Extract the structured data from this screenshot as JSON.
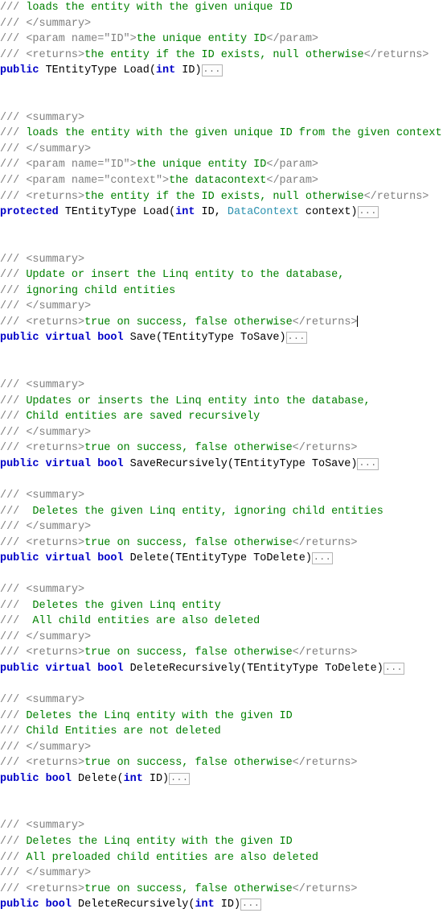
{
  "editor": {
    "kind": "code-editor-pane",
    "language": "C#",
    "background_color": "#ffffff",
    "colors": {
      "doc_tag": "#808080",
      "doc_text": "#008000",
      "keyword": "#0000C8",
      "type": "#2B91AF",
      "plain_text": "#000000",
      "collapsed_box_border": "#b4b4b4",
      "caret": "#000000"
    },
    "collapsed_region_label": "...",
    "caret_visible": true
  },
  "lines": [
    {
      "n": 1,
      "kind": "doc",
      "tokens": [
        {
          "t": "doc",
          "s": "/// "
        },
        {
          "t": "doctext",
          "s": "loads the entity with the given unique ID"
        }
      ]
    },
    {
      "n": 2,
      "kind": "doc",
      "tokens": [
        {
          "t": "doc",
          "s": "/// </summary>"
        }
      ]
    },
    {
      "n": 3,
      "kind": "doc",
      "tokens": [
        {
          "t": "doc",
          "s": "/// <param name=\"ID\">"
        },
        {
          "t": "doctext",
          "s": "the unique entity ID"
        },
        {
          "t": "doc",
          "s": "</param>"
        }
      ]
    },
    {
      "n": 4,
      "kind": "doc",
      "tokens": [
        {
          "t": "doc",
          "s": "/// <returns>"
        },
        {
          "t": "doctext",
          "s": "the entity if the ID exists, null otherwise"
        },
        {
          "t": "doc",
          "s": "</returns>"
        }
      ]
    },
    {
      "n": 5,
      "kind": "code",
      "tokens": [
        {
          "t": "keyword",
          "s": "public"
        },
        {
          "t": "plain",
          "s": " TEntityType Load("
        },
        {
          "t": "keyword",
          "s": "int"
        },
        {
          "t": "plain",
          "s": " ID)"
        },
        {
          "t": "collapsed",
          "s": "..."
        }
      ]
    },
    {
      "n": 6,
      "kind": "blank",
      "tokens": []
    },
    {
      "n": 7,
      "kind": "blank",
      "tokens": []
    },
    {
      "n": 8,
      "kind": "doc",
      "tokens": [
        {
          "t": "doc",
          "s": "/// <summary>"
        }
      ]
    },
    {
      "n": 9,
      "kind": "doc",
      "tokens": [
        {
          "t": "doc",
          "s": "/// "
        },
        {
          "t": "doctext",
          "s": "loads the entity with the given unique ID from the given context"
        }
      ]
    },
    {
      "n": 10,
      "kind": "doc",
      "tokens": [
        {
          "t": "doc",
          "s": "/// </summary>"
        }
      ]
    },
    {
      "n": 11,
      "kind": "doc",
      "tokens": [
        {
          "t": "doc",
          "s": "/// <param name=\"ID\">"
        },
        {
          "t": "doctext",
          "s": "the unique entity ID"
        },
        {
          "t": "doc",
          "s": "</param>"
        }
      ]
    },
    {
      "n": 12,
      "kind": "doc",
      "tokens": [
        {
          "t": "doc",
          "s": "/// <param name=\"context\">"
        },
        {
          "t": "doctext",
          "s": "the datacontext"
        },
        {
          "t": "doc",
          "s": "</param>"
        }
      ]
    },
    {
      "n": 13,
      "kind": "doc",
      "tokens": [
        {
          "t": "doc",
          "s": "/// <returns>"
        },
        {
          "t": "doctext",
          "s": "the entity if the ID exists, null otherwise"
        },
        {
          "t": "doc",
          "s": "</returns>"
        }
      ]
    },
    {
      "n": 14,
      "kind": "code",
      "tokens": [
        {
          "t": "keyword",
          "s": "protected"
        },
        {
          "t": "plain",
          "s": " TEntityType Load("
        },
        {
          "t": "keyword",
          "s": "int"
        },
        {
          "t": "plain",
          "s": " ID, "
        },
        {
          "t": "type",
          "s": "DataContext"
        },
        {
          "t": "plain",
          "s": " context)"
        },
        {
          "t": "collapsed",
          "s": "..."
        }
      ]
    },
    {
      "n": 15,
      "kind": "blank",
      "tokens": []
    },
    {
      "n": 16,
      "kind": "blank",
      "tokens": []
    },
    {
      "n": 17,
      "kind": "doc",
      "tokens": [
        {
          "t": "doc",
          "s": "/// <summary>"
        }
      ]
    },
    {
      "n": 18,
      "kind": "doc",
      "tokens": [
        {
          "t": "doc",
          "s": "/// "
        },
        {
          "t": "doctext",
          "s": "Update or insert the Linq entity to the database,"
        }
      ]
    },
    {
      "n": 19,
      "kind": "doc",
      "tokens": [
        {
          "t": "doc",
          "s": "/// "
        },
        {
          "t": "doctext",
          "s": "ignoring child entities"
        }
      ]
    },
    {
      "n": 20,
      "kind": "doc",
      "tokens": [
        {
          "t": "doc",
          "s": "/// </summary>"
        }
      ]
    },
    {
      "n": 21,
      "kind": "doc",
      "caret_at_end": true,
      "tokens": [
        {
          "t": "doc",
          "s": "/// <returns>"
        },
        {
          "t": "doctext",
          "s": "true on success, false otherwise"
        },
        {
          "t": "doc",
          "s": "</returns>"
        }
      ]
    },
    {
      "n": 22,
      "kind": "code",
      "tokens": [
        {
          "t": "keyword",
          "s": "public virtual bool"
        },
        {
          "t": "plain",
          "s": " Save(TEntityType ToSave)"
        },
        {
          "t": "collapsed",
          "s": "..."
        }
      ]
    },
    {
      "n": 23,
      "kind": "blank",
      "tokens": []
    },
    {
      "n": 24,
      "kind": "blank",
      "tokens": []
    },
    {
      "n": 25,
      "kind": "doc",
      "tokens": [
        {
          "t": "doc",
          "s": "/// <summary>"
        }
      ]
    },
    {
      "n": 26,
      "kind": "doc",
      "tokens": [
        {
          "t": "doc",
          "s": "/// "
        },
        {
          "t": "doctext",
          "s": "Updates or inserts the Linq entity into the database,"
        }
      ]
    },
    {
      "n": 27,
      "kind": "doc",
      "tokens": [
        {
          "t": "doc",
          "s": "/// "
        },
        {
          "t": "doctext",
          "s": "Child entities are saved recursively"
        }
      ]
    },
    {
      "n": 28,
      "kind": "doc",
      "tokens": [
        {
          "t": "doc",
          "s": "/// </summary>"
        }
      ]
    },
    {
      "n": 29,
      "kind": "doc",
      "tokens": [
        {
          "t": "doc",
          "s": "/// <returns>"
        },
        {
          "t": "doctext",
          "s": "true on success, false otherwise"
        },
        {
          "t": "doc",
          "s": "</returns>"
        }
      ]
    },
    {
      "n": 30,
      "kind": "code",
      "tokens": [
        {
          "t": "keyword",
          "s": "public virtual bool"
        },
        {
          "t": "plain",
          "s": " SaveRecursively(TEntityType ToSave)"
        },
        {
          "t": "collapsed",
          "s": "..."
        }
      ]
    },
    {
      "n": 31,
      "kind": "blank",
      "tokens": []
    },
    {
      "n": 32,
      "kind": "doc",
      "tokens": [
        {
          "t": "doc",
          "s": "/// <summary>"
        }
      ]
    },
    {
      "n": 33,
      "kind": "doc",
      "tokens": [
        {
          "t": "doc",
          "s": "/// "
        },
        {
          "t": "doctext",
          "s": " Deletes the given Linq entity, ignoring child entities"
        }
      ]
    },
    {
      "n": 34,
      "kind": "doc",
      "tokens": [
        {
          "t": "doc",
          "s": "/// </summary>"
        }
      ]
    },
    {
      "n": 35,
      "kind": "doc",
      "tokens": [
        {
          "t": "doc",
          "s": "/// <returns>"
        },
        {
          "t": "doctext",
          "s": "true on success, false otherwise"
        },
        {
          "t": "doc",
          "s": "</returns>"
        }
      ]
    },
    {
      "n": 36,
      "kind": "code",
      "tokens": [
        {
          "t": "keyword",
          "s": "public virtual bool"
        },
        {
          "t": "plain",
          "s": " Delete(TEntityType ToDelete)"
        },
        {
          "t": "collapsed",
          "s": "..."
        }
      ]
    },
    {
      "n": 37,
      "kind": "blank",
      "tokens": []
    },
    {
      "n": 38,
      "kind": "doc",
      "tokens": [
        {
          "t": "doc",
          "s": "/// <summary>"
        }
      ]
    },
    {
      "n": 39,
      "kind": "doc",
      "tokens": [
        {
          "t": "doc",
          "s": "/// "
        },
        {
          "t": "doctext",
          "s": " Deletes the given Linq entity"
        }
      ]
    },
    {
      "n": 40,
      "kind": "doc",
      "tokens": [
        {
          "t": "doc",
          "s": "/// "
        },
        {
          "t": "doctext",
          "s": " All child entities are also deleted"
        }
      ]
    },
    {
      "n": 41,
      "kind": "doc",
      "tokens": [
        {
          "t": "doc",
          "s": "/// </summary>"
        }
      ]
    },
    {
      "n": 42,
      "kind": "doc",
      "tokens": [
        {
          "t": "doc",
          "s": "/// <returns>"
        },
        {
          "t": "doctext",
          "s": "true on success, false otherwise"
        },
        {
          "t": "doc",
          "s": "</returns>"
        }
      ]
    },
    {
      "n": 43,
      "kind": "code",
      "tokens": [
        {
          "t": "keyword",
          "s": "public virtual bool"
        },
        {
          "t": "plain",
          "s": " DeleteRecursively(TEntityType ToDelete)"
        },
        {
          "t": "collapsed",
          "s": "..."
        }
      ]
    },
    {
      "n": 44,
      "kind": "blank",
      "tokens": []
    },
    {
      "n": 45,
      "kind": "doc",
      "tokens": [
        {
          "t": "doc",
          "s": "/// <summary>"
        }
      ]
    },
    {
      "n": 46,
      "kind": "doc",
      "tokens": [
        {
          "t": "doc",
          "s": "/// "
        },
        {
          "t": "doctext",
          "s": "Deletes the Linq entity with the given ID"
        }
      ]
    },
    {
      "n": 47,
      "kind": "doc",
      "tokens": [
        {
          "t": "doc",
          "s": "/// "
        },
        {
          "t": "doctext",
          "s": "Child Entities are not deleted"
        }
      ]
    },
    {
      "n": 48,
      "kind": "doc",
      "tokens": [
        {
          "t": "doc",
          "s": "/// </summary>"
        }
      ]
    },
    {
      "n": 49,
      "kind": "doc",
      "tokens": [
        {
          "t": "doc",
          "s": "/// <returns>"
        },
        {
          "t": "doctext",
          "s": "true on success, false otherwise"
        },
        {
          "t": "doc",
          "s": "</returns>"
        }
      ]
    },
    {
      "n": 50,
      "kind": "code",
      "tokens": [
        {
          "t": "keyword",
          "s": "public bool"
        },
        {
          "t": "plain",
          "s": " Delete("
        },
        {
          "t": "keyword",
          "s": "int"
        },
        {
          "t": "plain",
          "s": " ID)"
        },
        {
          "t": "collapsed",
          "s": "..."
        }
      ]
    },
    {
      "n": 51,
      "kind": "blank",
      "tokens": []
    },
    {
      "n": 52,
      "kind": "blank",
      "tokens": []
    },
    {
      "n": 53,
      "kind": "doc",
      "tokens": [
        {
          "t": "doc",
          "s": "/// <summary>"
        }
      ]
    },
    {
      "n": 54,
      "kind": "doc",
      "tokens": [
        {
          "t": "doc",
          "s": "/// "
        },
        {
          "t": "doctext",
          "s": "Deletes the Linq entity with the given ID"
        }
      ]
    },
    {
      "n": 55,
      "kind": "doc",
      "tokens": [
        {
          "t": "doc",
          "s": "/// "
        },
        {
          "t": "doctext",
          "s": "All preloaded child entities are also deleted"
        }
      ]
    },
    {
      "n": 56,
      "kind": "doc",
      "tokens": [
        {
          "t": "doc",
          "s": "/// </summary>"
        }
      ]
    },
    {
      "n": 57,
      "kind": "doc",
      "tokens": [
        {
          "t": "doc",
          "s": "/// <returns>"
        },
        {
          "t": "doctext",
          "s": "true on success, false otherwise"
        },
        {
          "t": "doc",
          "s": "</returns>"
        }
      ]
    },
    {
      "n": 58,
      "kind": "code",
      "tokens": [
        {
          "t": "keyword",
          "s": "public bool"
        },
        {
          "t": "plain",
          "s": " DeleteRecursively("
        },
        {
          "t": "keyword",
          "s": "int"
        },
        {
          "t": "plain",
          "s": " ID)"
        },
        {
          "t": "collapsed",
          "s": "..."
        }
      ]
    }
  ]
}
